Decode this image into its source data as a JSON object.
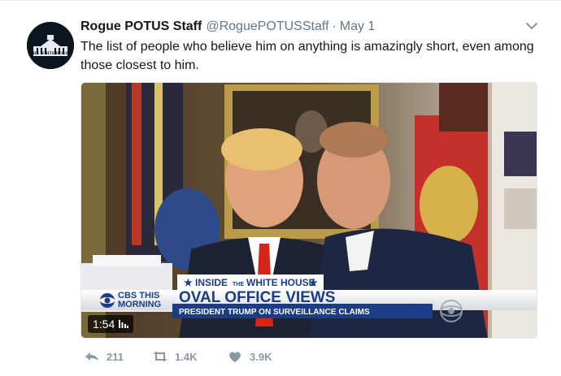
{
  "tweet": {
    "author_name": "Rogue POTUS Staff",
    "handle": "@RoguePOTUSStaff",
    "separator": "·",
    "time": "May 1",
    "text": "The list of people who believe him on anything is amazingly short, even among those closest to him.",
    "avatar_text": "THE WHITE HOUSE"
  },
  "video": {
    "lower_third_kicker_left": "INSIDE",
    "lower_third_kicker_small": "THE",
    "lower_third_kicker_right": "WHITE HOUSE",
    "network_line1": "CBS THIS",
    "network_line2": "MORNING",
    "headline": "OVAL OFFICE VIEWS",
    "subhead": "PRESIDENT TRUMP ON SURVEILLANCE CLAIMS",
    "duration": "1:54"
  },
  "actions": {
    "replies": "211",
    "retweets": "1.4K",
    "likes": "3.9K"
  },
  "colors": {
    "text": "#14171a",
    "muted": "#657786",
    "action_gray": "#8899a6",
    "cbs_blue": "#1a3d86"
  }
}
